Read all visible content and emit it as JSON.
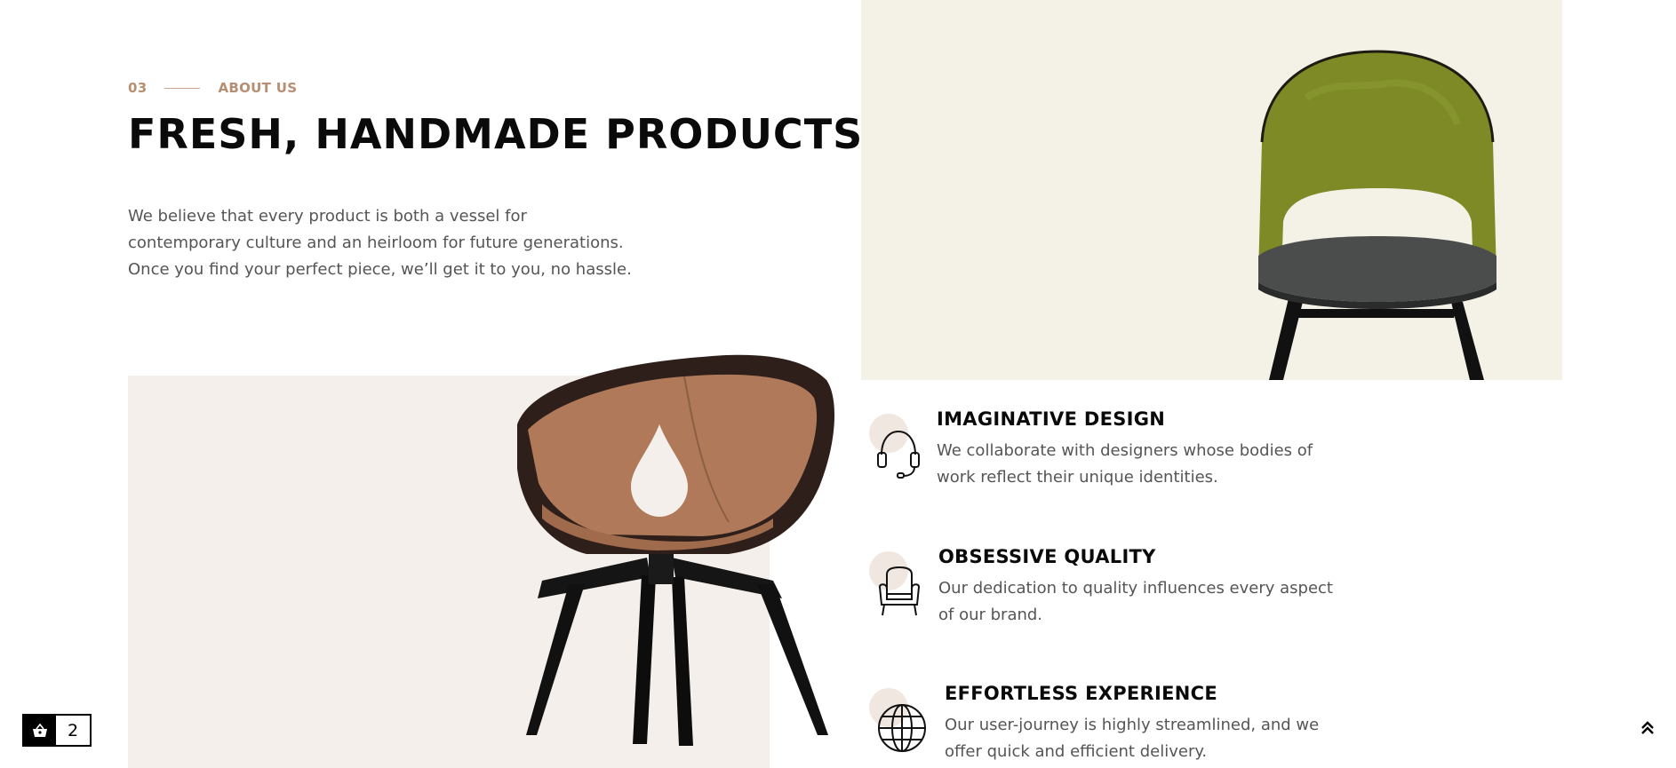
{
  "section": {
    "number": "03",
    "label": "ABOUT US",
    "title": "FRESH, HANDMADE PRODUCTS",
    "description": "We believe that every product is both a vessel for contemporary culture and an heirloom for future generations. Once you find your perfect piece, we’ll get it to you, no hassle."
  },
  "features": [
    {
      "icon": "headset-icon",
      "title": "IMAGINATIVE DESIGN",
      "text": "We collaborate with designers whose bodies of work reflect their unique identities."
    },
    {
      "icon": "armchair-icon",
      "title": "OBSESSIVE QUALITY",
      "text": "Our dedication to quality influences every aspect of our brand."
    },
    {
      "icon": "globe-icon",
      "title": "EFFORTLESS EXPERIENCE",
      "text": "Our user-journey is highly streamlined, and we offer quick and efficient delivery."
    }
  ],
  "cart": {
    "icon": "basket-icon",
    "count": "2"
  },
  "scroll_top": {
    "icon": "double-chevron-up-icon"
  },
  "colors": {
    "accent": "#b88e72",
    "panel_left_bg": "#f4efea",
    "panel_right_bg": "#f4f1e7",
    "icon_blob": "#f1e7e1"
  }
}
